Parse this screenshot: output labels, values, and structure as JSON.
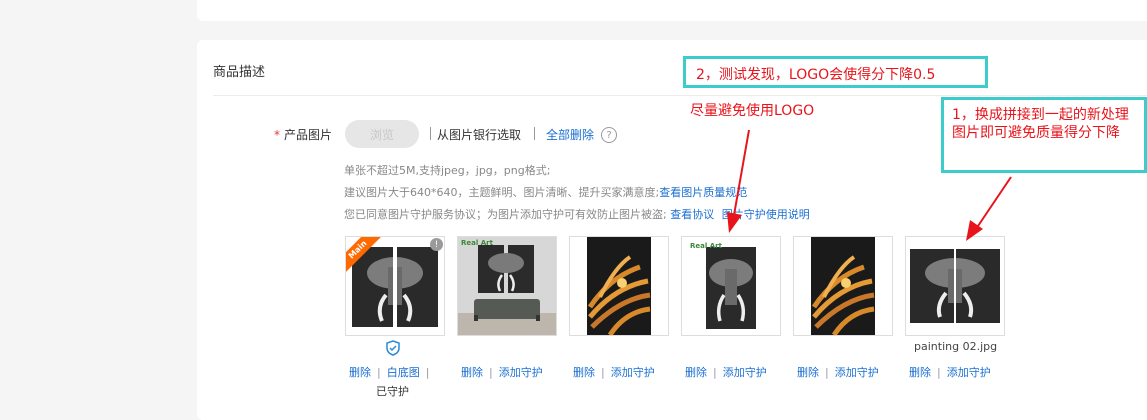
{
  "section": {
    "title": "商品描述"
  },
  "upload": {
    "required_mark": "*",
    "label": "产品图片",
    "browse": "浏览",
    "from_bank": "从图片银行选取",
    "delete_all": "全部删除",
    "help_symbol": "?"
  },
  "hints": {
    "line1": "单张不超过5M,支持jpeg，jpg，png格式;",
    "line2_text": "建议图片大于640*640，主题鲜明、图片清晰、提升买家满意度;",
    "line2_link": "查看图片质量规范",
    "line3_text": "您已同意图片守护服务协议；为图片添加守护可有效防止图片被盗;",
    "line3_link1": "查看协议",
    "line3_link2": "图片守护使用说明"
  },
  "thumbs": [
    {
      "badge": "Main",
      "info": "!",
      "actions": [
        "删除",
        "白底图"
      ],
      "status": "已守护"
    },
    {
      "logo": "Real Art",
      "actions": [
        "删除",
        "添加守护"
      ]
    },
    {
      "actions": [
        "删除",
        "添加守护"
      ]
    },
    {
      "logo": "Real Art",
      "actions": [
        "删除",
        "添加守护"
      ]
    },
    {
      "actions": [
        "删除",
        "添加守护"
      ]
    },
    {
      "filename": "painting 02.jpg",
      "actions": [
        "删除",
        "添加守护"
      ]
    }
  ],
  "annotations": {
    "note2": "2，测试发现，LOGO会使得分下降0.5",
    "note_logo": "尽量避免使用LOGO",
    "note1": "1，换成拼接到一起的新处理图片即可避免质量得分下降"
  },
  "colors": {
    "accent": "#1a6fd1",
    "annotation_red": "#e8141b",
    "annotation_border": "#3ccccc",
    "ribbon": "#ff6a00"
  }
}
